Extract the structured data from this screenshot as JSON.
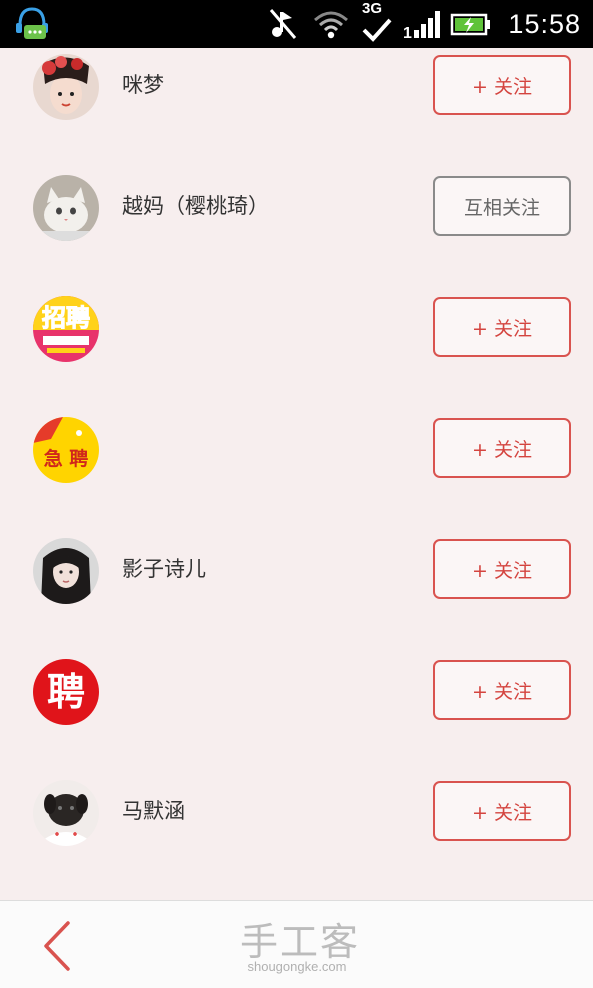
{
  "status_bar": {
    "time": "15:58",
    "network": "3G",
    "signal_label": "1",
    "icons": [
      "chat-app-icon",
      "mute-icon",
      "wifi-icon",
      "3g-icon",
      "signal-icon",
      "battery-icon"
    ]
  },
  "users": [
    {
      "name": "咪梦",
      "button": "+ 关注",
      "state": "follow",
      "avatar": "avatar-woman-flowers"
    },
    {
      "name": "越妈（樱桃琦）",
      "button": "互相关注",
      "state": "mutual",
      "avatar": "avatar-cat"
    },
    {
      "name": "",
      "button": "+ 关注",
      "state": "follow",
      "avatar": "avatar-recruit-poster"
    },
    {
      "name": "",
      "button": "+ 关注",
      "state": "follow",
      "avatar": "avatar-urgent-hiring"
    },
    {
      "name": "影子诗儿",
      "button": "+ 关注",
      "state": "follow",
      "avatar": "avatar-woman-longhair"
    },
    {
      "name": "",
      "button": "+ 关注",
      "state": "follow",
      "avatar": "avatar-hire-red"
    },
    {
      "name": "马默涵",
      "button": "+ 关注",
      "state": "follow",
      "avatar": "avatar-puppy"
    }
  ],
  "avatar_text": {
    "recruit": "招聘",
    "urgent": "急 聘",
    "hire": "聘"
  },
  "bottom_bar": {
    "logo_cn": "手工客",
    "logo_en": "shougongke.com"
  },
  "colors": {
    "accent": "#d9534f",
    "background": "#f7eeee",
    "mutual_border": "#8a8a8a"
  }
}
